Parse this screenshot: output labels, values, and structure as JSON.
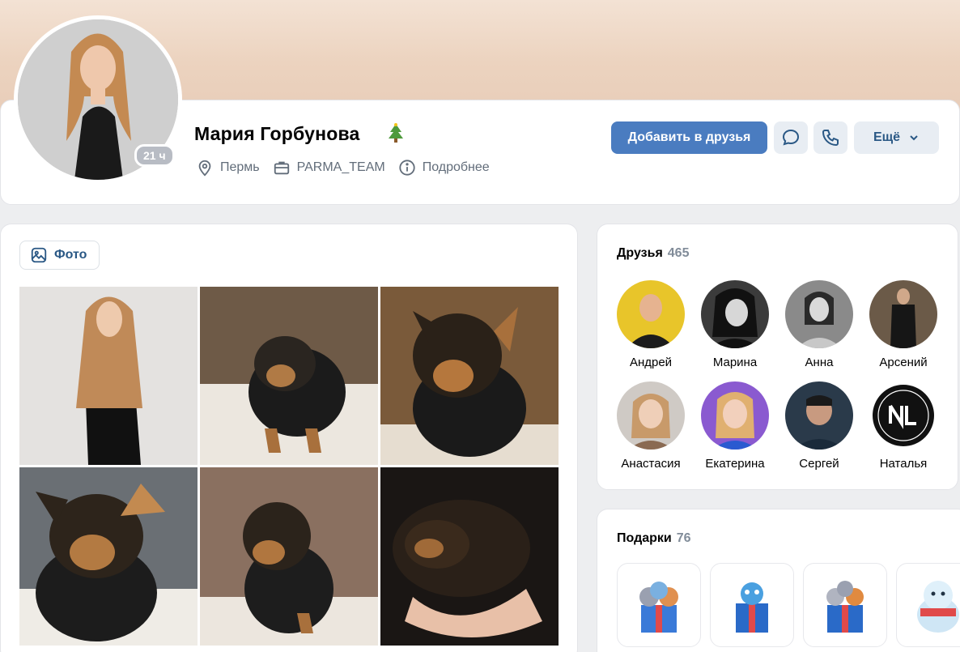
{
  "profile": {
    "name": "Мария Горбунова",
    "online": "21 ч",
    "city": "Пермь",
    "work": "PARMA_TEAM",
    "details": "Подробнее",
    "status_icon": "christmas-tree-icon"
  },
  "actions": {
    "add_friend": "Добавить в друзья",
    "more": "Ещё"
  },
  "photos": {
    "tab_label": "Фото"
  },
  "friends": {
    "title": "Друзья",
    "count": "465",
    "items": [
      {
        "name": "Андрей",
        "color": "#e8c52a"
      },
      {
        "name": "Марина",
        "color": "#3b3b3b"
      },
      {
        "name": "Анна",
        "color": "#8a8a8a"
      },
      {
        "name": "Арсений",
        "color": "#5a4a3a"
      },
      {
        "name": "Анастасия",
        "color": "#d9b8a0"
      },
      {
        "name": "Екатерина",
        "color": "#8a5ad0"
      },
      {
        "name": "Сергей",
        "color": "#2a3a4a"
      },
      {
        "name": "Наталья",
        "color": "#111111"
      }
    ]
  },
  "gifts": {
    "title": "Подарки",
    "count": "76"
  },
  "colors": {
    "primary": "#4a7cc0",
    "secondary_bg": "#e8edf3",
    "link": "#2a5885",
    "muted": "#818c99"
  }
}
